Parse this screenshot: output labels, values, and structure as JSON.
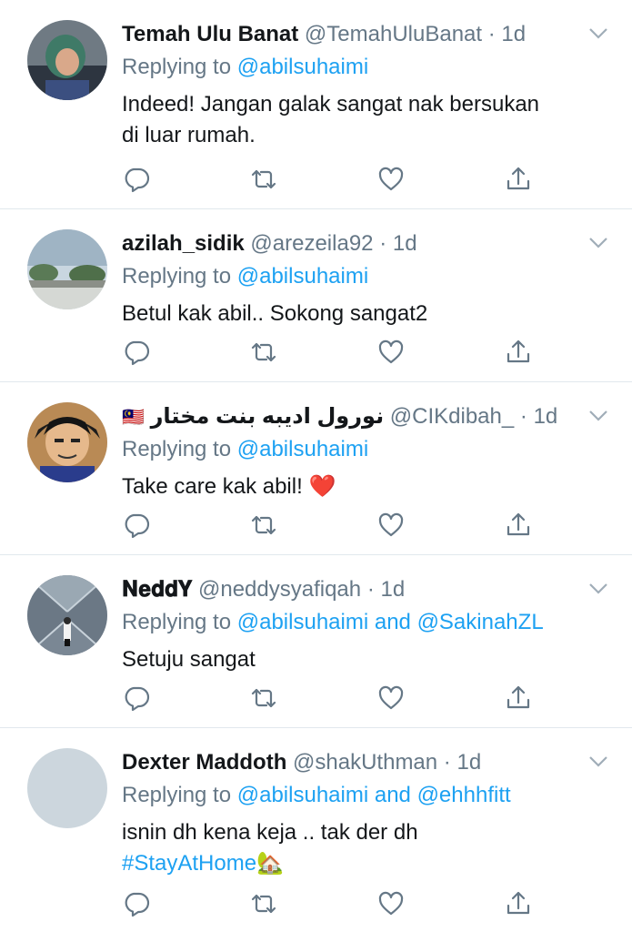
{
  "tweets": [
    {
      "display_name": "Temah Ulu Banat",
      "handle": "@TemahUluBanat",
      "dot": "·",
      "time": "1d",
      "replying_prefix": "Replying to",
      "mentions": [
        "@abilsuhaimi"
      ],
      "mention_joiner": "",
      "text_lines": [
        "Indeed! Jangan galak sangat nak bersukan",
        "di luar rumah."
      ],
      "avatar": "elderly-woman-photo"
    },
    {
      "display_name": "azilah_sidik",
      "handle": "@arezeila92",
      "dot": "·",
      "time": "1d",
      "replying_prefix": "Replying to",
      "mentions": [
        "@abilsuhaimi"
      ],
      "mention_joiner": "",
      "text_lines": [
        "Betul kak abil.. Sokong sangat2"
      ],
      "avatar": "landscape-photo"
    },
    {
      "flag": "🇲🇾",
      "display_name": "نورول اديبه بنت مختار",
      "handle": "@CIKdibah_",
      "dot": "·",
      "time": "1d",
      "replying_prefix": "Replying to",
      "mentions": [
        "@abilsuhaimi"
      ],
      "mention_joiner": "",
      "text_lines": [
        "Take care kak abil! "
      ],
      "text_emoji": "❤️",
      "avatar": "anime-character"
    },
    {
      "display_name": "𝐍𝐞𝐝𝐝𝐘",
      "handle": "@neddysyafiqah",
      "dot": "·",
      "time": "1d",
      "replying_prefix": "Replying to",
      "mentions": [
        "@abilsuhaimi",
        "@SakinahZL"
      ],
      "mention_joiner": "and",
      "text_lines": [
        "Setuju sangat"
      ],
      "avatar": "tunnel-photo"
    },
    {
      "display_name": "Dexter Maddoth",
      "handle": "@shakUthman",
      "dot": "·",
      "time": "1d",
      "replying_prefix": "Replying to",
      "mentions": [
        "@abilsuhaimi",
        "@ehhhfitt"
      ],
      "mention_joiner": "and",
      "text_lines": [
        "isnin dh kena keja .. tak der dh"
      ],
      "hashtag": "#StayAtHome",
      "hashtag_emoji": "🏡",
      "avatar": "default-avatar"
    }
  ],
  "icons": {
    "reply": "reply-icon",
    "retweet": "retweet-icon",
    "like": "heart-icon",
    "share": "share-icon",
    "more": "chevron-down-icon"
  },
  "colors": {
    "link": "#1da1f2",
    "secondary_text": "#657786",
    "primary_text": "#14171a",
    "divider": "#e1e8ed"
  }
}
